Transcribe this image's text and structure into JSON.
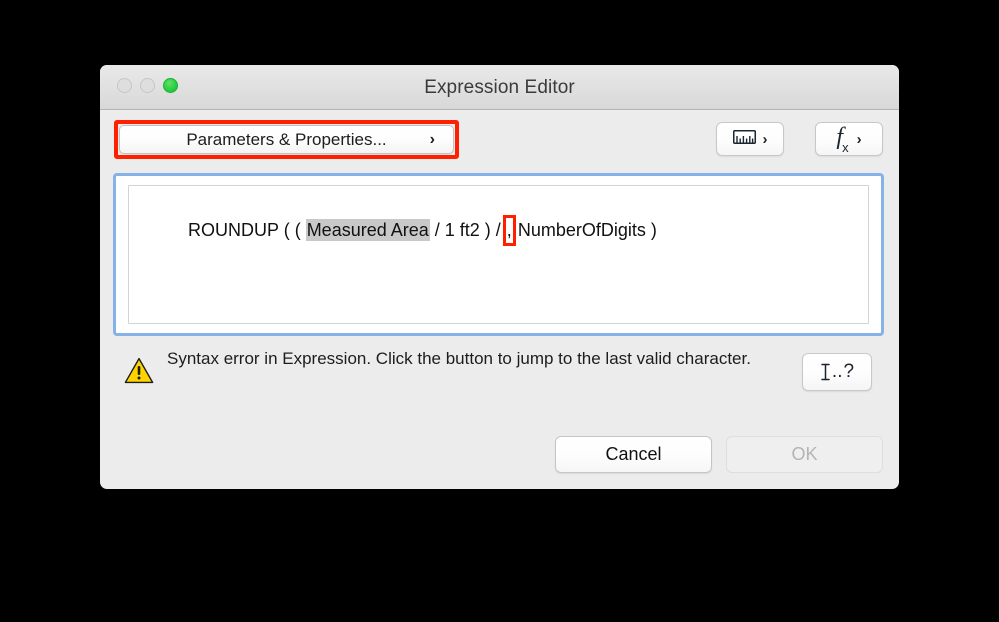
{
  "window": {
    "title": "Expression Editor",
    "traffic_lights": [
      {
        "name": "close",
        "state": "disabled",
        "color": "#dedede"
      },
      {
        "name": "minimize",
        "state": "disabled",
        "color": "#dedede"
      },
      {
        "name": "maximize",
        "state": "enabled",
        "color": "#28cd41"
      }
    ]
  },
  "toolbar": {
    "parameters_button": {
      "label": "Parameters & Properties...",
      "chevron": "›",
      "annotated": true,
      "annotation_color": "#ff2000"
    },
    "ruler_button": {
      "icon": "ruler-icon",
      "chevron": "›"
    },
    "function_button": {
      "icon": "fx-icon",
      "glyph_main": "f",
      "glyph_sub": "x",
      "chevron": "›"
    }
  },
  "expression": {
    "focused": true,
    "focus_ring_color": "#87b2e8",
    "full_text": "ROUNDUP ( ( Measured Area / 1 ft2 ) / , NumberOfDigits )",
    "segments": [
      {
        "text": "ROUNDUP ( ( ",
        "style": "plain"
      },
      {
        "text": "Measured Area",
        "style": "token"
      },
      {
        "text": " / 1 ft2 ) / ",
        "style": "plain"
      },
      {
        "text": ",",
        "style": "annotated"
      },
      {
        "text": " NumberOfDigits )",
        "style": "plain"
      }
    ],
    "token_background": "#c9c9c9",
    "annotation_color": "#ff2000"
  },
  "warning": {
    "icon": "warning-triangle-icon",
    "icon_color": "#ffd400",
    "message": "Syntax error in Expression. Click the button to jump to the last valid character.",
    "jump_button": {
      "glyph": "I...?",
      "icon": "text-cursor-icon"
    }
  },
  "footer": {
    "cancel_label": "Cancel",
    "cancel_enabled": true,
    "ok_label": "OK",
    "ok_enabled": false
  }
}
